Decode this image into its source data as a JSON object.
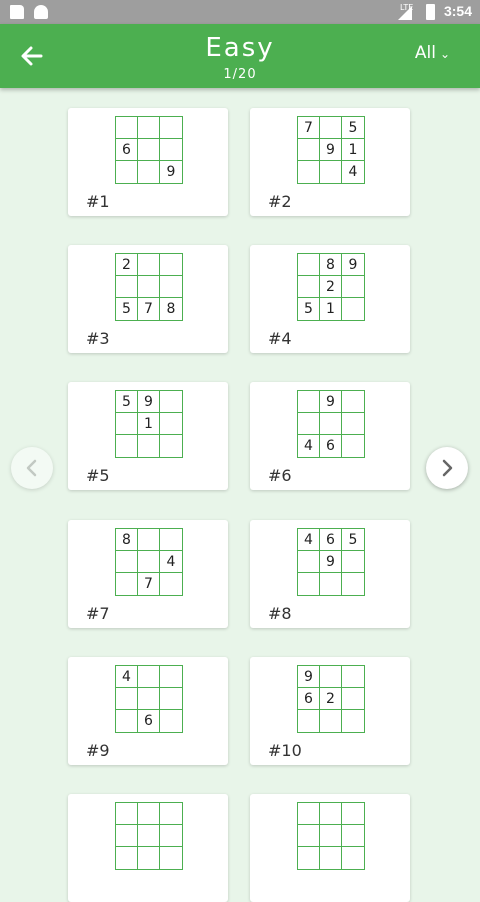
{
  "status": {
    "time": "3:54",
    "network": "LTE"
  },
  "header": {
    "title": "Easy",
    "subtitle": "1/20",
    "filter_label": "All"
  },
  "icons": {
    "back": "arrow-left",
    "prev": "chevron-left",
    "next": "chevron-right",
    "filter": "chevron-down"
  },
  "colors": {
    "accent": "#4caf50",
    "background": "#e8f5e9"
  },
  "puzzles": [
    {
      "label": "#1",
      "grid": [
        "",
        "",
        "",
        "6",
        "",
        "",
        "",
        "",
        "9"
      ]
    },
    {
      "label": "#2",
      "grid": [
        "7",
        "",
        "5",
        "",
        "9",
        "1",
        "",
        "",
        "4"
      ]
    },
    {
      "label": "#3",
      "grid": [
        "2",
        "",
        "",
        "",
        "",
        "",
        "5",
        "7",
        "8"
      ]
    },
    {
      "label": "#4",
      "grid": [
        "",
        "8",
        "9",
        "",
        "2",
        "",
        "5",
        "1",
        ""
      ]
    },
    {
      "label": "#5",
      "grid": [
        "5",
        "9",
        "",
        "",
        "1",
        "",
        "",
        "",
        ""
      ]
    },
    {
      "label": "#6",
      "grid": [
        "",
        "9",
        "",
        "",
        "",
        "",
        "4",
        "6",
        ""
      ]
    },
    {
      "label": "#7",
      "grid": [
        "8",
        "",
        "",
        "",
        "",
        "4",
        "",
        "7",
        ""
      ]
    },
    {
      "label": "#8",
      "grid": [
        "4",
        "6",
        "5",
        "",
        "9",
        "",
        "",
        "",
        ""
      ]
    },
    {
      "label": "#9",
      "grid": [
        "4",
        "",
        "",
        "",
        "",
        "",
        "",
        "6",
        ""
      ]
    },
    {
      "label": "#10",
      "grid": [
        "9",
        "",
        "",
        "6",
        "2",
        "",
        "",
        "",
        ""
      ]
    },
    {
      "label": "",
      "grid": [
        "",
        "",
        "",
        "",
        "",
        "",
        "",
        "",
        ""
      ]
    },
    {
      "label": "",
      "grid": [
        "",
        "",
        "",
        "",
        "",
        "",
        "",
        "",
        ""
      ]
    }
  ]
}
